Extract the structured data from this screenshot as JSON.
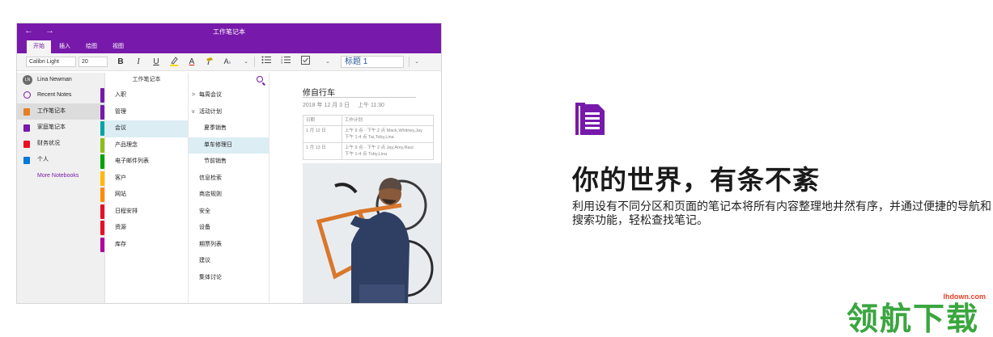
{
  "app": {
    "window_title": "工作笔记本",
    "nav_arrows": "←  →",
    "tabs": [
      {
        "label": "开始",
        "active": true
      },
      {
        "label": "插入",
        "active": false
      },
      {
        "label": "绘图",
        "active": false
      },
      {
        "label": "视图",
        "active": false
      }
    ],
    "toolbar": {
      "font_name": "Calibri Light",
      "font_size": "20",
      "bold": "B",
      "italic": "I",
      "underline": "U",
      "font_color": "A",
      "style_heading": "标题 1"
    },
    "notebooks_pane": {
      "user_initials": "LN",
      "user_name": "Lina Newman",
      "items": [
        {
          "label": "Recent Notes",
          "icon": "clock-icon",
          "color": "#7719aa",
          "active": false
        },
        {
          "label": "工作笔记本",
          "icon": "notebook-icon",
          "color": "#e67e22",
          "active": true
        },
        {
          "label": "家庭笔记本",
          "icon": "notebook-icon",
          "color": "#7719aa",
          "active": false
        },
        {
          "label": "财务状况",
          "icon": "notebook-icon",
          "color": "#e81123",
          "active": false
        },
        {
          "label": "个人",
          "icon": "notebook-icon",
          "color": "#0078d7",
          "active": false
        }
      ],
      "more_label": "More Notebooks"
    },
    "sections_pane": {
      "header": "工作笔记本",
      "items": [
        {
          "label": "入职",
          "color": "#7719aa"
        },
        {
          "label": "管理",
          "color": "#7719aa"
        },
        {
          "label": "会议",
          "color": "#00a4a6",
          "active": true
        },
        {
          "label": "产品理念",
          "color": "#8cbd18"
        },
        {
          "label": "电子邮件列表",
          "color": "#00a300"
        },
        {
          "label": "客户",
          "color": "#ffb900"
        },
        {
          "label": "网站",
          "color": "#ff8c00"
        },
        {
          "label": "日程安排",
          "color": "#e81123"
        },
        {
          "label": "资源",
          "color": "#e81123"
        },
        {
          "label": "库存",
          "color": "#b4009e"
        }
      ]
    },
    "pages_pane": {
      "items": [
        {
          "label": "每周会议",
          "chevron": ">",
          "sub": false
        },
        {
          "label": "活动计划",
          "chevron": "v",
          "sub": false
        },
        {
          "label": "夏季销售",
          "sub": true
        },
        {
          "label": "单车修理日",
          "sub": true,
          "active": true
        },
        {
          "label": "节前销售",
          "sub": true
        },
        {
          "label": "信息检索",
          "sub": false
        },
        {
          "label": "商店规则",
          "sub": false
        },
        {
          "label": "安全",
          "sub": false
        },
        {
          "label": "设备",
          "sub": false
        },
        {
          "label": "期票列表",
          "sub": false
        },
        {
          "label": "建议",
          "sub": false
        },
        {
          "label": "集体讨论",
          "sub": false
        }
      ]
    },
    "note": {
      "title": "修自行车",
      "date": "2018 年 12 月 3 日",
      "time": "上午 11:30",
      "table": {
        "headers": [
          "日期",
          "工作计划"
        ],
        "rows": [
          [
            "1 月 12 日",
            "上午 9 点 - 下午 2 点 Mack,Whitney,Jay\n下午 1-4 点 Tai,Toby,Lina"
          ],
          [
            "1 月 13 日",
            "上午 9 点 - 下午 2 点 Jay,Amy,Raul\n下午 1-4 点 Toby,Lina"
          ]
        ]
      }
    }
  },
  "promo": {
    "icon": "onenote-page-icon",
    "icon_color": "#7719aa",
    "headline": "你的世界，有条不紊",
    "description": "利用设有不同分区和页面的笔记本将所有内容整理地井然有序，并通过便捷的导航和搜索功能，轻松查找笔记。"
  },
  "watermark": {
    "text": "领航下载",
    "url": "lhdown.com"
  }
}
